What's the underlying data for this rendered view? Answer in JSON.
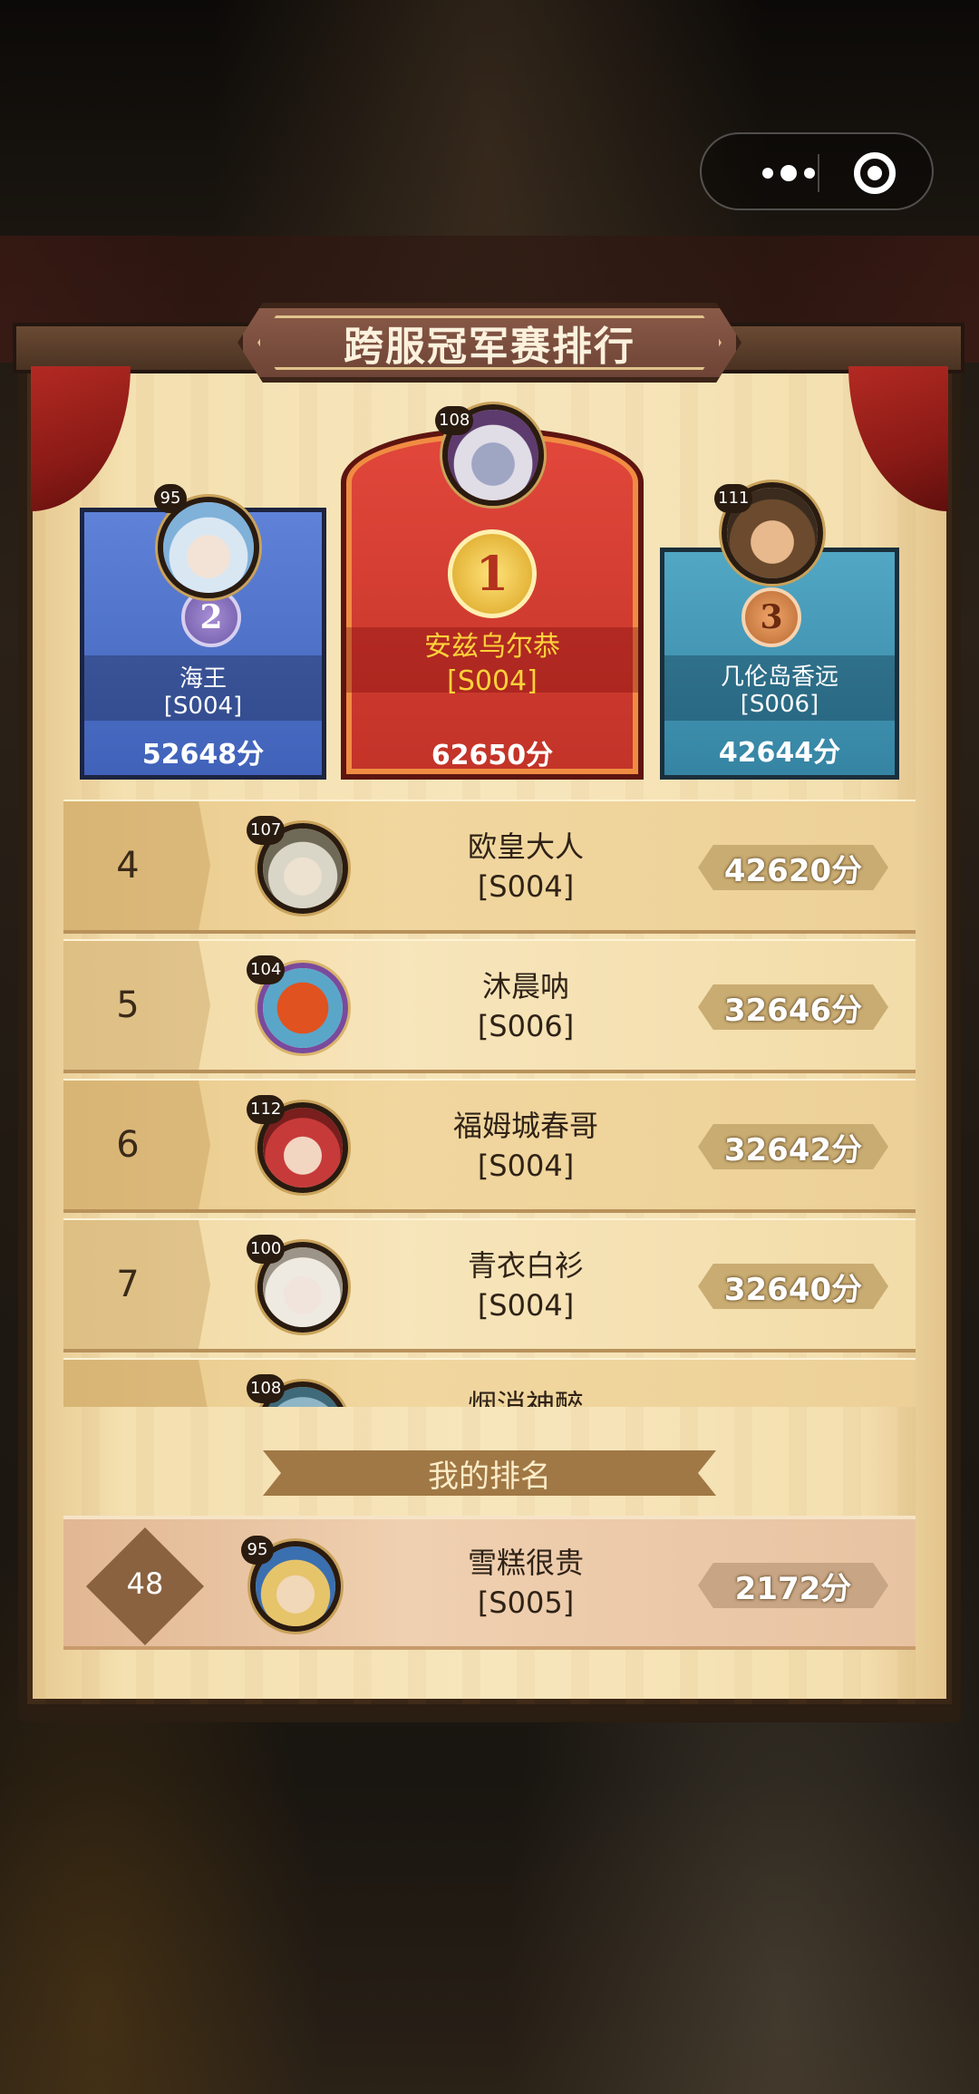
{
  "title": "跨服冠军赛排行",
  "podium": [
    {
      "place": "2",
      "level": "95",
      "name": "海王",
      "server": "[S004]",
      "score": "52648分",
      "color": "#4a6cc6"
    },
    {
      "place": "1",
      "level": "108",
      "name": "安兹乌尔恭",
      "server": "[S004]",
      "score": "62650分",
      "color": "#d23c30"
    },
    {
      "place": "3",
      "level": "111",
      "name": "几伦岛香远",
      "server": "[S006]",
      "score": "42644分",
      "color": "#3f94b4"
    }
  ],
  "rankings": [
    {
      "rank": "4",
      "level": "107",
      "name": "欧皇大人",
      "server": "[S004]",
      "score": "42620分",
      "avatar": "silver-hair-knight"
    },
    {
      "rank": "5",
      "level": "104",
      "name": "沐晨呐",
      "server": "[S006]",
      "score": "32646分",
      "avatar": "orange-blob-creature"
    },
    {
      "rank": "6",
      "level": "112",
      "name": "福姆城春哥",
      "server": "[S004]",
      "score": "32642分",
      "avatar": "red-hair-heroine"
    },
    {
      "rank": "7",
      "level": "100",
      "name": "青衣白衫",
      "server": "[S004]",
      "score": "32640分",
      "avatar": "white-hair-girl"
    },
    {
      "rank": "",
      "level": "108",
      "name": "烟消神醉",
      "server": "",
      "score": "",
      "avatar": "crowned-hero"
    }
  ],
  "my_rank": {
    "label": "我的排名",
    "rank": "48",
    "level": "95",
    "name": "雪糕很贵",
    "server": "[S005]",
    "score": "2172分"
  },
  "icons": {
    "menu": "more-dots-icon",
    "close": "target-circle-icon"
  }
}
